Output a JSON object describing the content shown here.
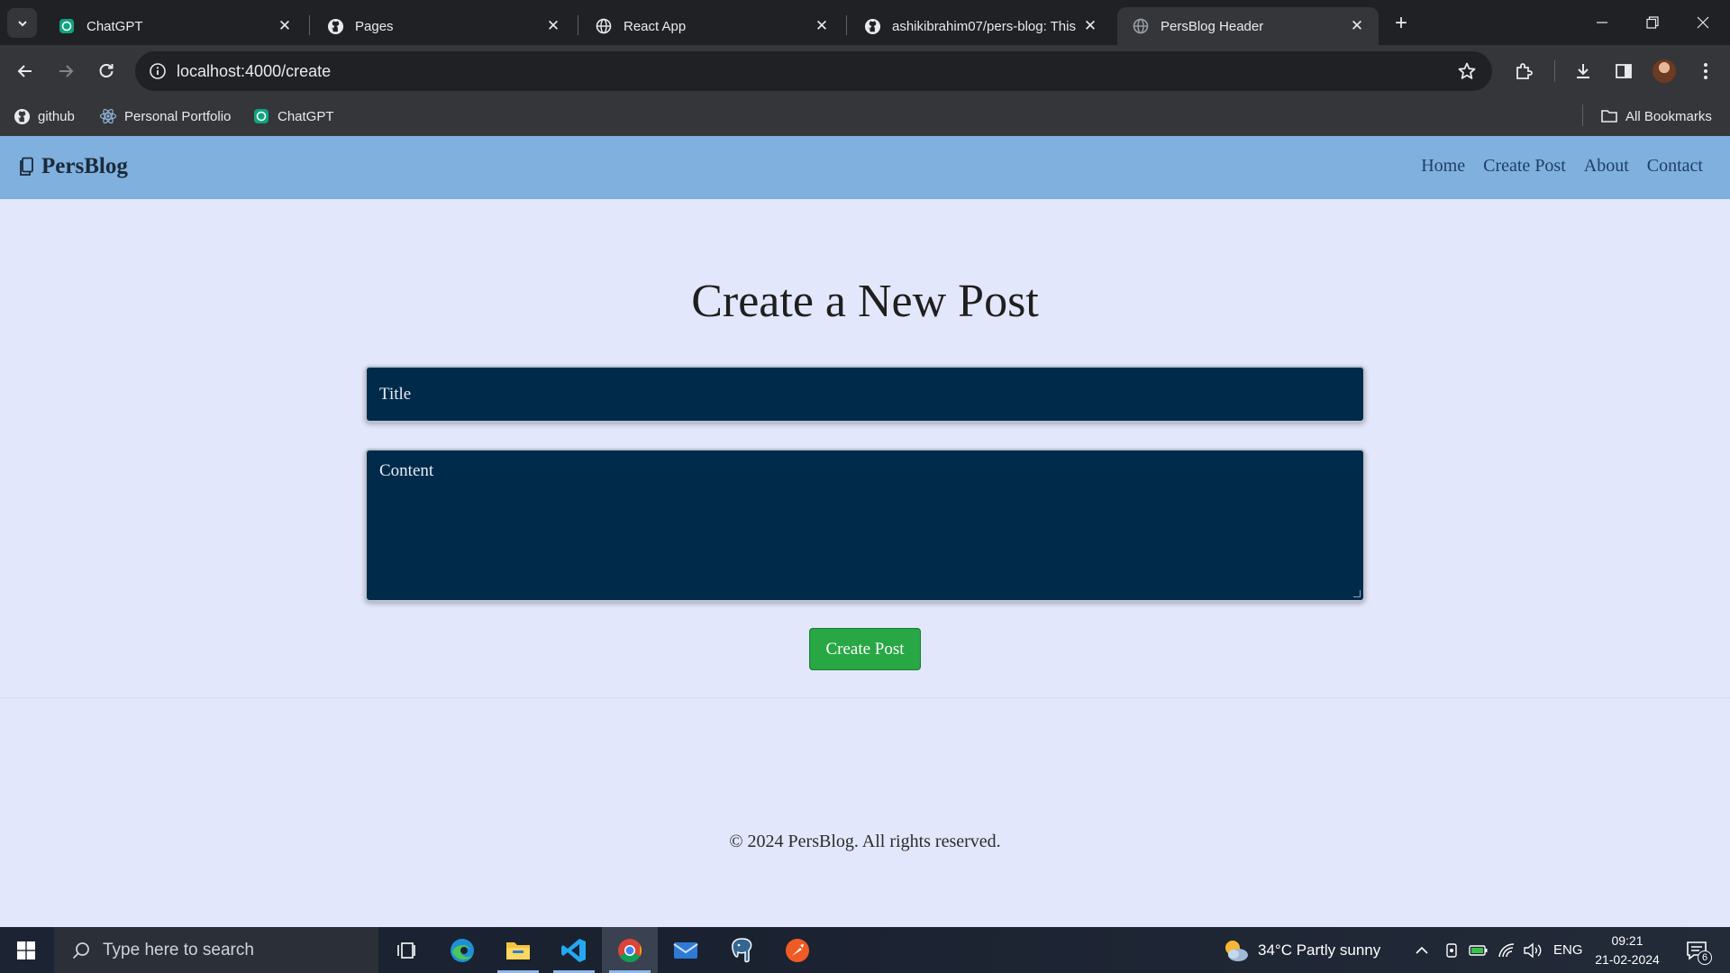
{
  "browser": {
    "tabs": [
      {
        "label": "ChatGPT",
        "icon": "chatgpt-icon",
        "active": false
      },
      {
        "label": "Pages",
        "icon": "github-icon",
        "active": false
      },
      {
        "label": "React App",
        "icon": "globe-icon",
        "active": false
      },
      {
        "label": "ashikibrahim07/pers-blog: This",
        "icon": "github-icon",
        "active": false
      },
      {
        "label": "PersBlog Header",
        "icon": "globe-icon",
        "active": true
      }
    ],
    "url": "localhost:4000/create",
    "bookmarks": [
      {
        "label": "github",
        "icon": "github-icon"
      },
      {
        "label": "Personal Portfolio",
        "icon": "react-icon"
      },
      {
        "label": "ChatGPT",
        "icon": "chatgpt-icon"
      }
    ],
    "all_bookmarks_label": "All Bookmarks"
  },
  "site": {
    "brand": "PersBlog",
    "nav": [
      "Home",
      "Create Post",
      "About",
      "Contact"
    ],
    "page_title": "Create a New Post",
    "title_placeholder": "Title",
    "content_placeholder": "Content",
    "submit_label": "Create Post",
    "footer": "© 2024 PersBlog. All rights reserved."
  },
  "taskbar": {
    "search_placeholder": "Type here to search",
    "weather": "34°C  Partly sunny",
    "language": "ENG",
    "time": "09:21",
    "date": "21-02-2024",
    "notifications_count": "6"
  },
  "colors": {
    "header_bg": "#7fb0de",
    "page_bg": "#e3e7fb",
    "field_bg": "#002a4a",
    "button_bg": "#28a745"
  }
}
